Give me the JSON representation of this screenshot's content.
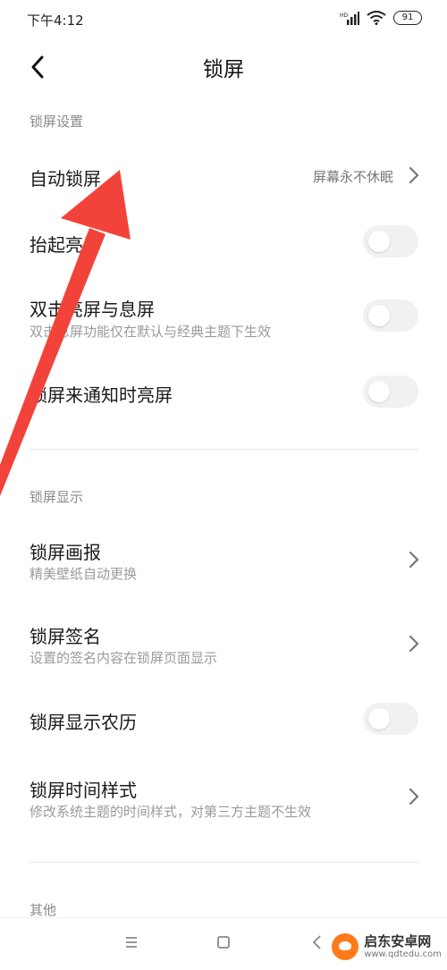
{
  "status": {
    "time": "下午4:12",
    "signal_label": "HD",
    "battery": "91"
  },
  "header": {
    "title": "锁屏"
  },
  "sections": {
    "settings_label": "锁屏设置",
    "display_label": "锁屏显示",
    "other_label": "其他"
  },
  "rows": {
    "auto_lock": {
      "title": "自动锁屏",
      "value": "屏幕永不休眠"
    },
    "lift_wake": {
      "title": "抬起亮屏"
    },
    "double_tap": {
      "title": "双击亮屏与息屏",
      "subtitle": "双击息屏功能仅在默认与经典主题下生效"
    },
    "notify_wake": {
      "title": "锁屏来通知时亮屏"
    },
    "wallpaper": {
      "title": "锁屏画报",
      "subtitle": "精美壁纸自动更换"
    },
    "signature": {
      "title": "锁屏签名",
      "subtitle": "设置的签名内容在锁屏页面显示"
    },
    "lunar": {
      "title": "锁屏显示农历"
    },
    "clock_style": {
      "title": "锁屏时间样式",
      "subtitle": "修改系统主题的时间样式，对第三方主题不生效"
    }
  },
  "toggles": {
    "lift_wake": false,
    "double_tap": false,
    "notify_wake": false,
    "lunar": false
  },
  "watermark": {
    "name": "启东安卓网",
    "url": "www.qdtedu.com"
  },
  "colors": {
    "arrow": "#f2433a",
    "label_gray": "#8a8a8a",
    "watermark_orange": "#ff7a1a"
  }
}
